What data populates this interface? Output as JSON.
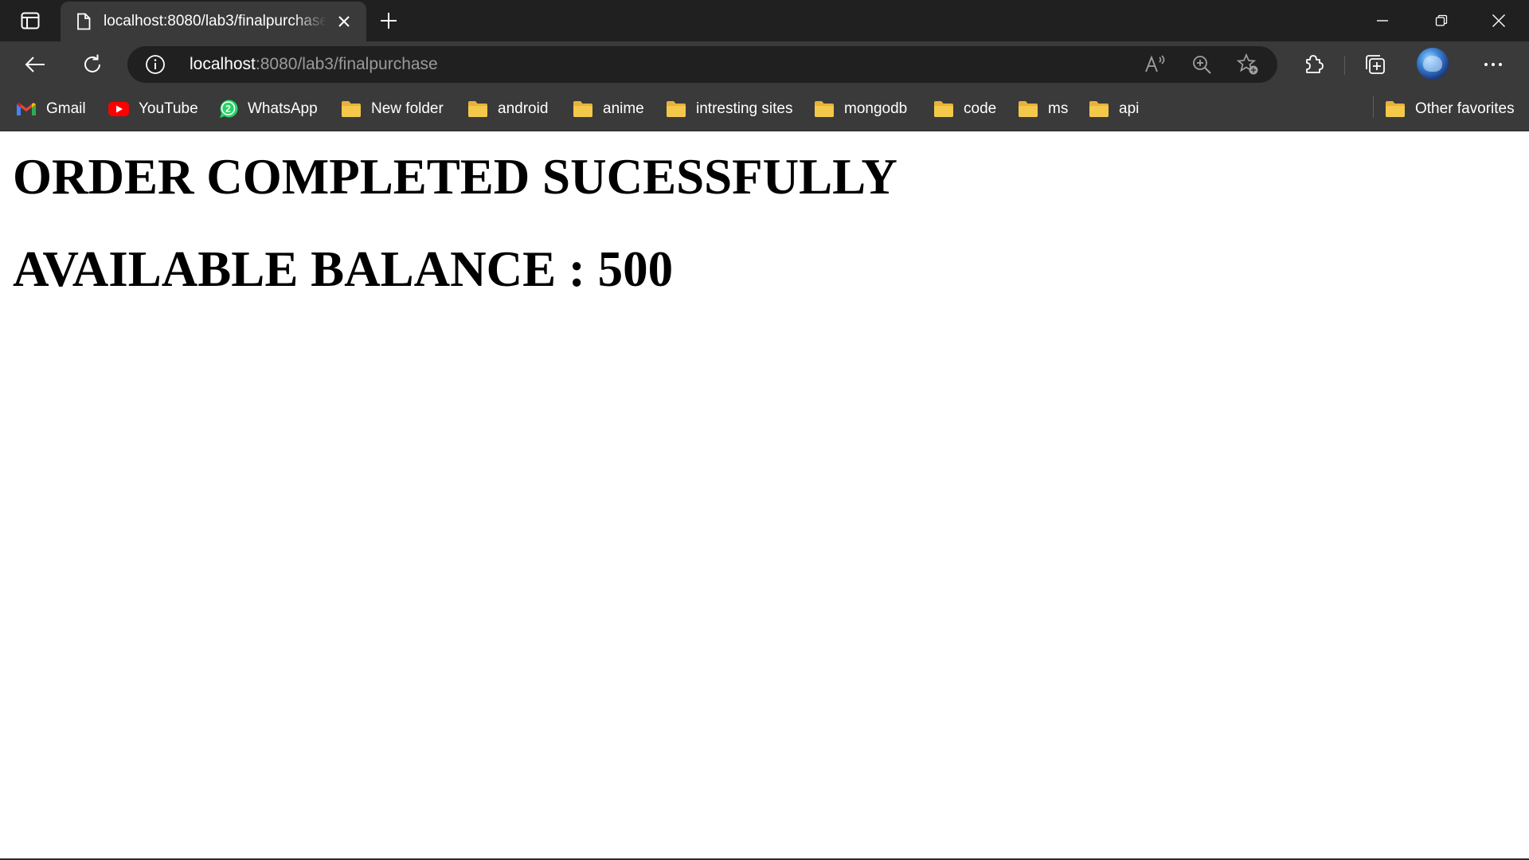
{
  "tab": {
    "title": "localhost:8080/lab3/finalpurchase",
    "favicon": "page-icon"
  },
  "address_bar": {
    "host": "localhost",
    "path": ":8080/lab3/finalpurchase",
    "info_icon": "info-icon"
  },
  "bookmarks": [
    {
      "label": "Gmail",
      "icon": "gmail-icon"
    },
    {
      "label": "YouTube",
      "icon": "youtube-icon"
    },
    {
      "label": "WhatsApp",
      "icon": "whatsapp-icon",
      "badge": "2"
    },
    {
      "label": "New folder",
      "icon": "folder-icon"
    },
    {
      "label": "android",
      "icon": "folder-icon"
    },
    {
      "label": "anime",
      "icon": "folder-icon"
    },
    {
      "label": "intresting sites",
      "icon": "folder-icon"
    },
    {
      "label": "mongodb",
      "icon": "folder-icon"
    },
    {
      "label": "code",
      "icon": "folder-icon"
    },
    {
      "label": "ms",
      "icon": "folder-icon"
    },
    {
      "label": "api",
      "icon": "folder-icon"
    }
  ],
  "other_favorites": {
    "label": "Other favorites",
    "icon": "folder-icon"
  },
  "page": {
    "heading_order": "ORDER COMPLETED SUCESSFULLY",
    "heading_balance": "AVAILABLE BALANCE : 500"
  },
  "colors": {
    "tabbar_bg": "#202020",
    "toolbar_bg": "#3a3a3a",
    "folder": "#f3c84b",
    "youtube_red": "#ff0000",
    "whatsapp_green": "#25d366"
  }
}
